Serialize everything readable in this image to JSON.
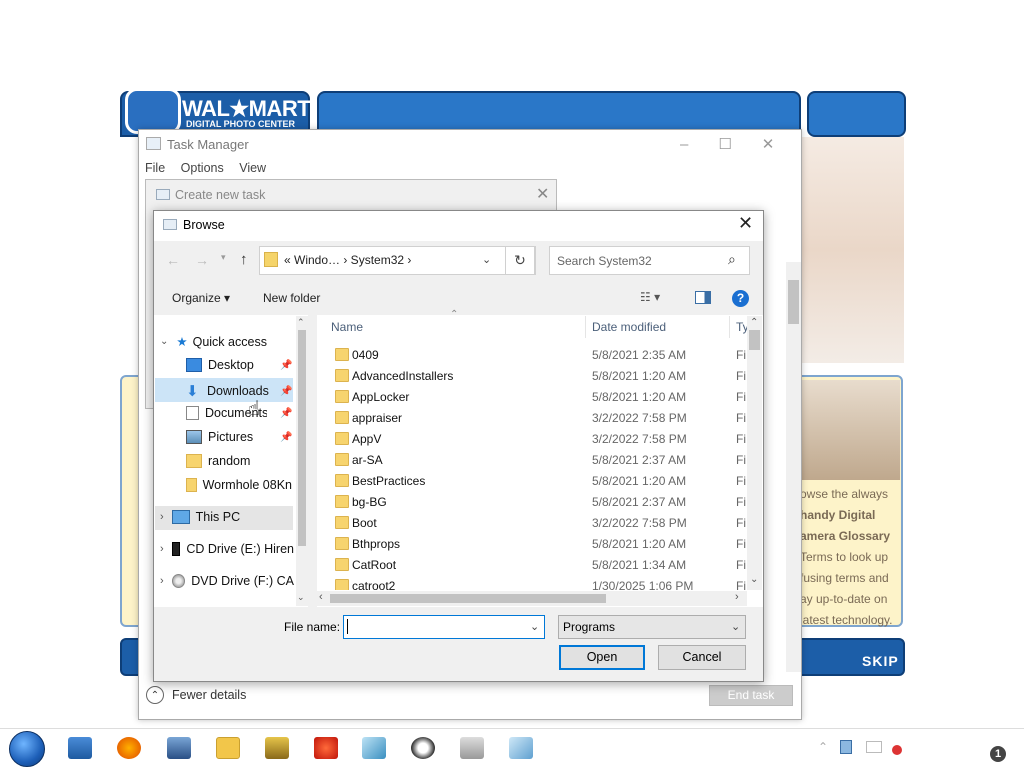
{
  "background_app": {
    "logo_text": "WAL★MART",
    "logo_subtitle": "DIGITAL PHOTO CENTER",
    "side_text": [
      "owse the always",
      "handy Digital",
      "amera Glossary",
      "Terms to look up",
      "fusing terms and",
      "ay up-to-date on",
      "latest technology."
    ],
    "skip_label": "Skip"
  },
  "task_manager": {
    "title": "Task Manager",
    "menu": [
      "File",
      "Options",
      "View"
    ],
    "fewer_details": "Fewer details",
    "end_task": "End task"
  },
  "create_new_task": {
    "title": "Create new task"
  },
  "browse": {
    "title": "Browse",
    "address_path": "«  Windo…  ›  System32  ›",
    "search_placeholder": "Search System32",
    "toolbar": {
      "organize": "Organize ▾",
      "new_folder": "New folder"
    },
    "nav": [
      {
        "label": "Quick access",
        "icon": "star-icon"
      },
      {
        "label": "Desktop",
        "icon": "desktop-icon"
      },
      {
        "label": "Downloads",
        "icon": "download-arrow-icon"
      },
      {
        "label": "Documents",
        "icon": "document-icon"
      },
      {
        "label": "Pictures",
        "icon": "pictures-icon"
      },
      {
        "label": "random",
        "icon": "folder-icon"
      },
      {
        "label": "Wormhole 08Kn",
        "icon": "folder-icon"
      },
      {
        "label": "This PC",
        "icon": "computer-icon"
      },
      {
        "label": "CD Drive (E:) Hiren",
        "icon": "cd-drive-icon"
      },
      {
        "label": "DVD Drive (F:) CA",
        "icon": "dvd-drive-icon"
      }
    ],
    "columns": [
      "Name",
      "Date modified",
      "Ty"
    ],
    "files": [
      {
        "name": "0409",
        "date": "5/8/2021 2:35 AM",
        "type": "Fi"
      },
      {
        "name": "AdvancedInstallers",
        "date": "5/8/2021 1:20 AM",
        "type": "Fi"
      },
      {
        "name": "AppLocker",
        "date": "5/8/2021 1:20 AM",
        "type": "Fi"
      },
      {
        "name": "appraiser",
        "date": "3/2/2022 7:58 PM",
        "type": "Fi"
      },
      {
        "name": "AppV",
        "date": "3/2/2022 7:58 PM",
        "type": "Fi"
      },
      {
        "name": "ar-SA",
        "date": "5/8/2021 2:37 AM",
        "type": "Fi"
      },
      {
        "name": "BestPractices",
        "date": "5/8/2021 1:20 AM",
        "type": "Fi"
      },
      {
        "name": "bg-BG",
        "date": "5/8/2021 2:37 AM",
        "type": "Fi"
      },
      {
        "name": "Boot",
        "date": "3/2/2022 7:58 PM",
        "type": "Fi"
      },
      {
        "name": "Bthprops",
        "date": "5/8/2021 1:20 AM",
        "type": "Fi"
      },
      {
        "name": "CatRoot",
        "date": "5/8/2021 1:34 AM",
        "type": "Fi"
      },
      {
        "name": "catroot2",
        "date": "1/30/2025 1:06 PM",
        "type": "Fi"
      }
    ],
    "file_name_label": "File name:",
    "file_name_value": "",
    "file_type": "Programs",
    "open_label": "Open",
    "cancel_label": "Cancel"
  },
  "taskbar": {
    "notification_count": "1",
    "apps": [
      "file-explorer-icon",
      "firefox-icon",
      "network-icon",
      "folder-icon",
      "bee-icon",
      "flame-icon",
      "book-icon",
      "flash-icon",
      "photo-icon",
      "window-icon"
    ]
  },
  "colors": {
    "walmart_blue": "#1c5ea8",
    "selection": "#cce4f7",
    "accent": "#0078d7"
  }
}
